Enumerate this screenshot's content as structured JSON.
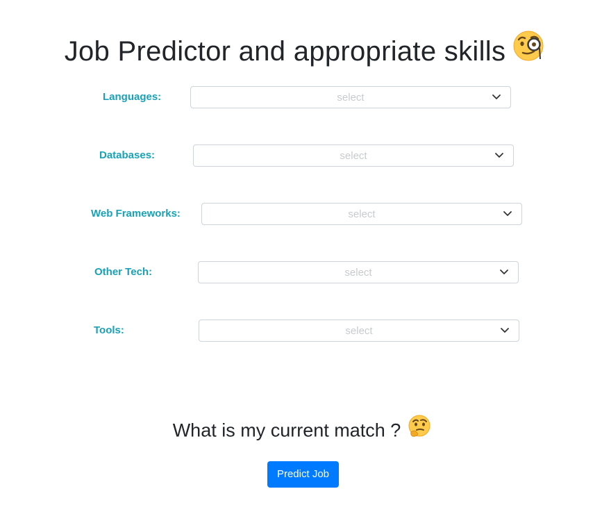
{
  "page": {
    "title": "Job Predictor and appropriate skills",
    "title_icon": "face-with-monocle-icon",
    "subtitle": "What is my current match ?",
    "subtitle_icon": "thinking-face-icon"
  },
  "form": {
    "fields": [
      {
        "label": "Languages:",
        "placeholder": "select",
        "icon": "chevron-down-icon"
      },
      {
        "label": "Databases:",
        "placeholder": "select",
        "icon": "chevron-down-icon"
      },
      {
        "label": "Web Frameworks:",
        "placeholder": "select",
        "icon": "chevron-down-icon"
      },
      {
        "label": "Other Tech:",
        "placeholder": "select",
        "icon": "chevron-down-icon"
      },
      {
        "label": "Tools:",
        "placeholder": "select",
        "icon": "chevron-down-icon"
      }
    ],
    "submit_label": "Predict Job"
  },
  "colors": {
    "label": "#17a2b8",
    "button": "#007bff",
    "placeholder": "#c8cbce",
    "border": "#ced4da",
    "text": "#212529"
  }
}
